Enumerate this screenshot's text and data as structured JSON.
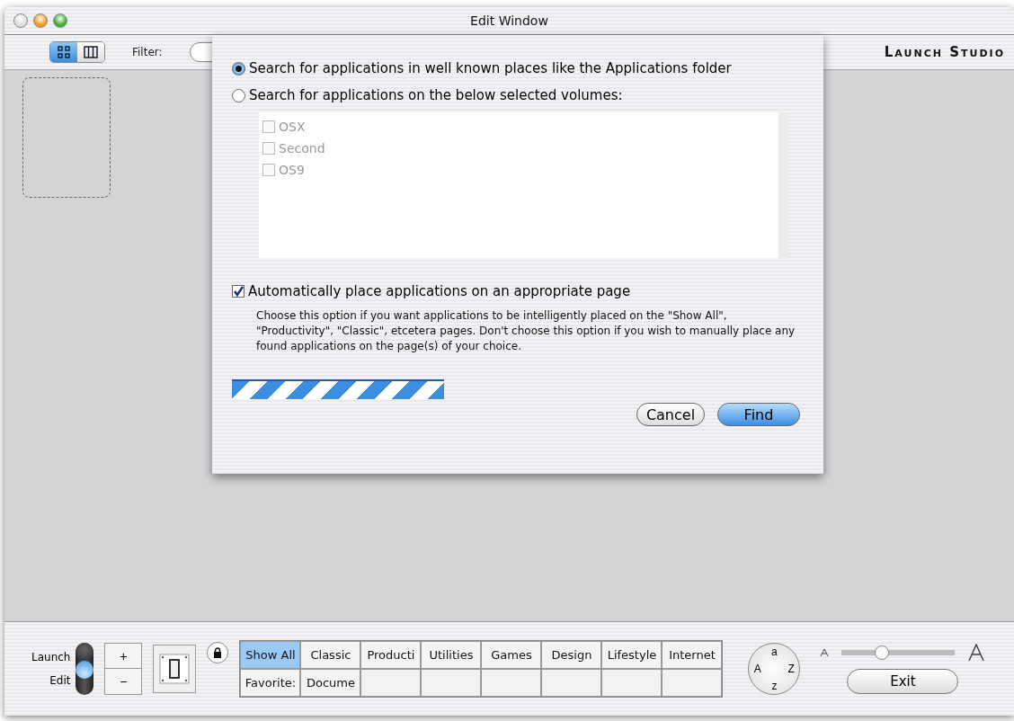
{
  "window": {
    "title": "Edit Window"
  },
  "toolbar": {
    "views": [
      {
        "kind": "grid",
        "selected": true
      },
      {
        "kind": "columns",
        "selected": false
      }
    ],
    "filter_label": "Filter:",
    "brand": "Launch Studio"
  },
  "sheet": {
    "options": [
      {
        "label": "Search for applications in well known places like the Applications folder",
        "selected": true
      },
      {
        "label": "Search for applications on the below selected volumes:",
        "selected": false
      }
    ],
    "volumes": [
      {
        "name": "OSX",
        "checked": false,
        "disabled": true
      },
      {
        "name": "Second",
        "checked": false,
        "disabled": true
      },
      {
        "name": "OS9",
        "checked": false,
        "disabled": true
      }
    ],
    "auto_place": {
      "label": "Automatically place applications on an appropriate page",
      "checked": true
    },
    "description": "Choose this option if you want applications to be intelligently placed on the \"Show All\", \"Productivity\", \"Classic\", etcetera pages. Don't choose this option if you wish to manually place any found applications on the page(s) of your choice.",
    "buttons": [
      {
        "label": "Cancel",
        "kind": "normal"
      },
      {
        "label": "Find",
        "kind": "default"
      }
    ]
  },
  "progress": {
    "busy": true
  },
  "bottom_bar": {
    "mode": [
      {
        "label": "Launch",
        "selected": false
      },
      {
        "label": "Edit",
        "selected": true
      }
    ],
    "stepper": [
      "+",
      "−"
    ],
    "tabs": [
      [
        {
          "label": "Show All",
          "selected": true
        },
        {
          "label": "Classic",
          "selected": false
        },
        {
          "label": "Producti",
          "selected": false
        },
        {
          "label": "Utilities",
          "selected": false
        },
        {
          "label": "Games",
          "selected": false
        },
        {
          "label": "Design",
          "selected": false
        },
        {
          "label": "Lifestyle",
          "selected": false
        },
        {
          "label": "Internet",
          "selected": false
        }
      ],
      [
        {
          "label": "Favorite:",
          "selected": false
        },
        {
          "label": "Docume",
          "selected": false
        }
      ]
    ],
    "sort_dial": [
      "a",
      "A",
      "Z",
      "z"
    ],
    "size_slider": {
      "level": 0.35
    },
    "exit": "Exit"
  }
}
